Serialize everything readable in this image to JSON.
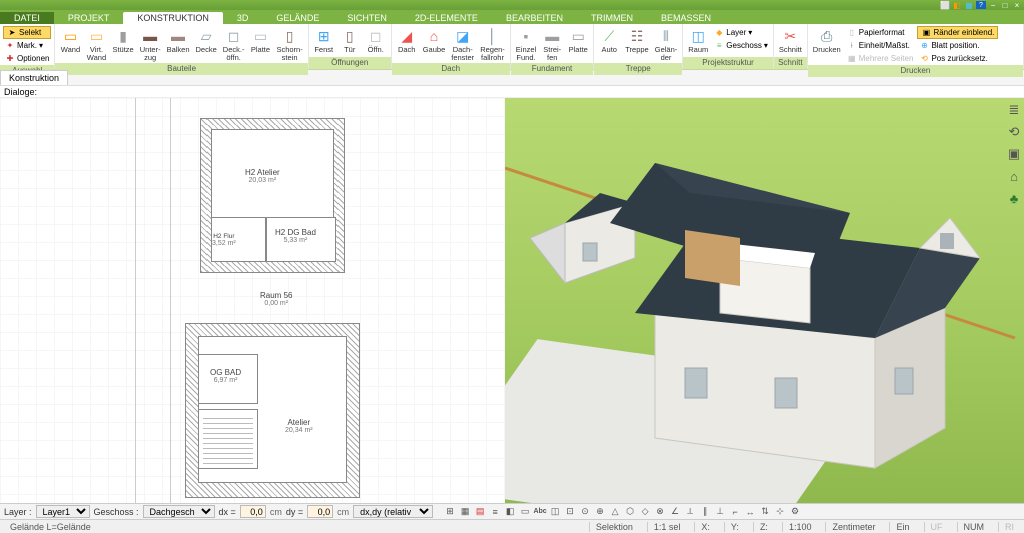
{
  "menutabs": {
    "datei": "DATEI",
    "projekt": "PROJEKT",
    "konstruktion": "KONSTRUKTION",
    "dreid": "3D",
    "gelaende": "GELÄNDE",
    "sichten": "SICHTEN",
    "zweid": "2D-ELEMENTE",
    "bearbeiten": "BEARBEITEN",
    "trimmen": "TRIMMEN",
    "bemassen": "BEMASSEN"
  },
  "ribbon": {
    "auswahl": {
      "label": "Auswahl",
      "selekt": "Selekt",
      "mark": "Mark.",
      "optionen": "Optionen"
    },
    "bauteile": {
      "label": "Bauteile",
      "wand": "Wand",
      "virtwand": "Virt.\nWand",
      "stuetze": "Stütze",
      "unterzug": "Unter-\nzug",
      "balken": "Balken",
      "decke": "Decke",
      "deckoeffn": "Deck.-\nöffn.",
      "platte": "Platte",
      "schornstein": "Schorn-\nstein"
    },
    "oeffnungen": {
      "label": "Öffnungen",
      "fenst": "Fenst",
      "tuer": "Tür",
      "oeffn": "Öffn."
    },
    "dach": {
      "label": "Dach",
      "dach": "Dach",
      "gaube": "Gaube",
      "dachfenster": "Dach-\nfenster",
      "regenfallrohr": "Regen-\nfallrohr"
    },
    "fundament": {
      "label": "Fundament",
      "einzelfund": "Einzel\nFund.",
      "streifen": "Strei-\nfen",
      "platte": "Platte"
    },
    "treppe": {
      "label": "Treppe",
      "auto": "Auto",
      "treppe": "Treppe",
      "gelaender": "Gelän-\nder"
    },
    "projektstruktur": {
      "label": "Projektstruktur",
      "raum": "Raum",
      "layer": "Layer",
      "geschoss": "Geschoss"
    },
    "schnitt": {
      "label": "Schnitt",
      "schnitt": "Schnitt"
    },
    "drucken": {
      "label": "Drucken",
      "drucken": "Drucken",
      "papierformat": "Papierformat",
      "einheit": "Einheit/Maßst.",
      "mehrere": "Mehrere Seiten",
      "raender": "Ränder einblend.",
      "blattpos": "Blatt position.",
      "posreset": "Pos zurücksetz."
    }
  },
  "subtab": "Konstruktion",
  "dialoge": "Dialoge:",
  "plan": {
    "h2atelier": {
      "name": "H2 Atelier",
      "area": "20,03 m²"
    },
    "h2flur": {
      "name": "H2 Flur",
      "area": "3,52 m²"
    },
    "h2dgbad": {
      "name": "H2 DG Bad",
      "area": "5,33 m²"
    },
    "raum56": {
      "name": "Raum 56",
      "area": "0,00 m²"
    },
    "ogbad": {
      "name": "OG BAD",
      "area": "6,97 m²"
    },
    "atelier": {
      "name": "Atelier",
      "area": "20,34 m²"
    }
  },
  "optbar": {
    "layer_label": "Layer :",
    "layer_value": "Layer1",
    "geschoss_label": "Geschoss :",
    "geschoss_value": "Dachgesch",
    "dx_label": "dx =",
    "dx_value": "0,0",
    "dy_label": "dy =",
    "dy_value": "0,0",
    "unit": "cm",
    "mode": "dx,dy (relativ ka"
  },
  "statusbar": {
    "gelaende": "Gelände L=Gelände",
    "selektion": "Selektion",
    "sel_count": "1:1 sel",
    "x": "X:",
    "y": "Y:",
    "z": "Z:",
    "scale": "1:100",
    "unit": "Zentimeter",
    "ein": "Ein",
    "uf": "UF",
    "num": "NUM",
    "ri": "RI"
  }
}
